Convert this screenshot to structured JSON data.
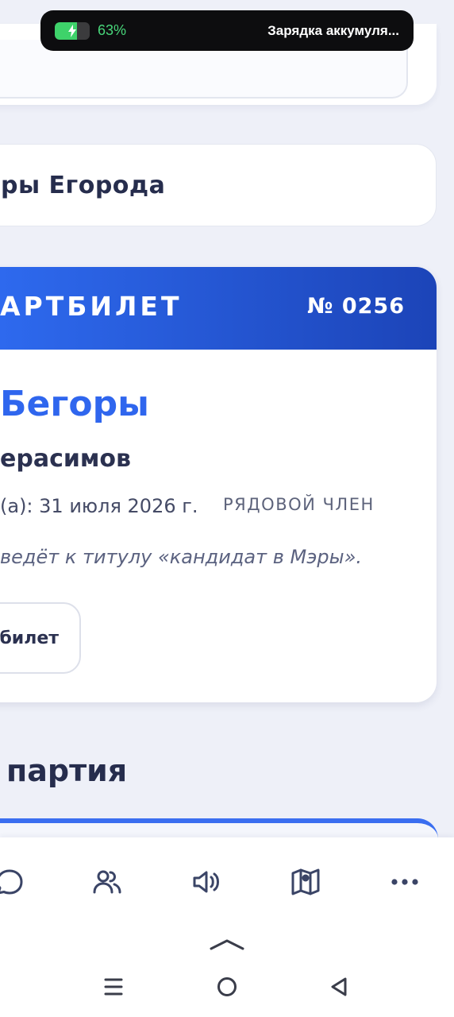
{
  "status_bar": {
    "battery_percent": "63%",
    "battery_level": 0.63,
    "notification": "Зарядка аккумуля..."
  },
  "title_card": {
    "text": "ры Егорода"
  },
  "ticket": {
    "header_title": "АРТБИЛЕТ",
    "number": "№ 0256",
    "name": "Бегоры",
    "person": "ерасимов",
    "date": "(а): 31 июля 2026 г.",
    "rank": "РЯДОВОЙ ЧЛЕН",
    "note": "ведёт к титулу «кандидат в Мэры».",
    "button_label": "билет",
    "colors": {
      "header_start": "#2f6cf2",
      "header_end": "#1c44b8",
      "name": "#2f66ee"
    }
  },
  "section": {
    "heading": "партия"
  },
  "bottom_nav": {
    "items": [
      {
        "icon": "chat-icon"
      },
      {
        "icon": "users-icon"
      },
      {
        "icon": "megaphone-icon"
      },
      {
        "icon": "map-icon"
      },
      {
        "icon": "more-icon"
      }
    ]
  },
  "system_nav": {
    "items": [
      {
        "icon": "expand-up-icon"
      },
      {
        "icon": "recent-apps-icon"
      },
      {
        "icon": "home-icon"
      },
      {
        "icon": "back-icon"
      }
    ]
  }
}
